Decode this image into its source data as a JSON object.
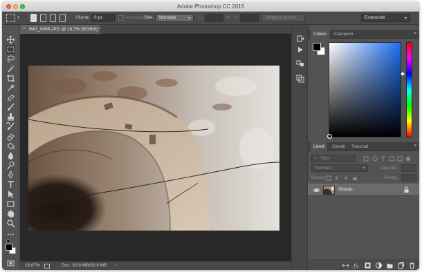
{
  "window": {
    "title": "Adobe Photoshop CC 2015"
  },
  "options_bar": {
    "feather_label": "Sfuma:",
    "feather_value": "0 px",
    "antialias_label": "Anti-alias",
    "style_label": "Stile:",
    "style_value": "Normale",
    "width_label": "L:",
    "height_label": "A:",
    "refine_edge_button": "Migliora bordo...",
    "workspace_value": "Essenziali"
  },
  "document": {
    "tab_label": "IMG_0068.JPG @ 16,7% (RGB/8) *",
    "close_glyph": "×"
  },
  "status_bar": {
    "zoom": "16,67%",
    "doc_info": "Doc: 30,9 MB/30,9 MB",
    "arrow": "›"
  },
  "color_panel": {
    "tabs": [
      "Colore",
      "Campioni"
    ],
    "foreground_color": "#000000",
    "background_color": "#ffffff",
    "hue_color": "#1d6ff2"
  },
  "layers_panel": {
    "tabs": [
      "Livelli",
      "Canali",
      "Tracciati"
    ],
    "filter_placeholder": "Tipo",
    "blend_mode": "Normale",
    "opacity_label": "Opacità:",
    "lock_label": "Blocca:",
    "fill_label": "Riemp.:",
    "layers": [
      {
        "name": "Sfondo",
        "visible": true,
        "locked": true
      }
    ]
  },
  "colors": {
    "window_bg": "#535353",
    "canvas_bg": "#282828",
    "panel_tab_bg": "#404040"
  }
}
